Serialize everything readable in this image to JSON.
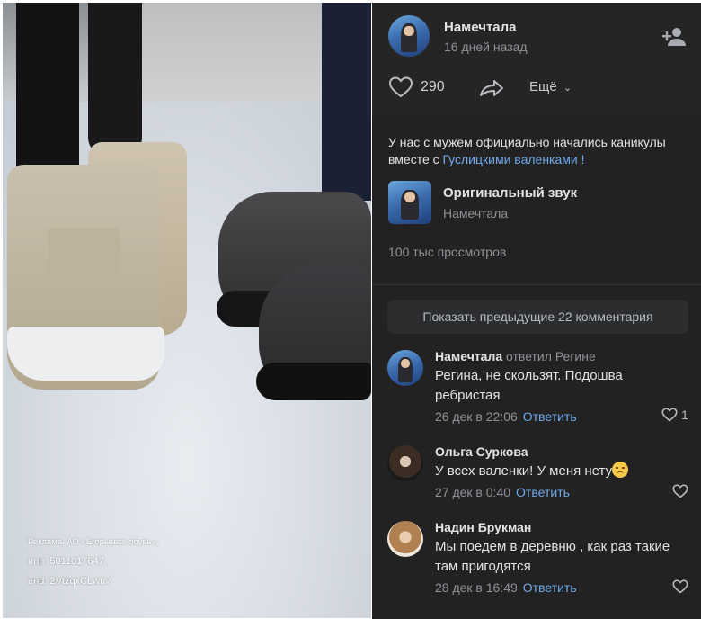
{
  "video": {
    "ad_lines": [
      "Реклама, АО «Егорьевск-обувь»,",
      "инн: 5011017647,",
      "erid: 2VtzqxCLwuv"
    ]
  },
  "post": {
    "author": "Намечтала",
    "date": "16 дней назад",
    "likes": "290",
    "more_label": "Ещё",
    "text_prefix": "У нас с мужем официально начались каникулы вместе с ",
    "text_link": "Гуслицкими валенками !",
    "sound_name": "Оригинальный звук",
    "sound_author": "Намечтала",
    "views": "100 тыс просмотров"
  },
  "comments_section": {
    "show_previous_label": "Показать предыдущие 22 комментария",
    "comments": [
      {
        "author": "Намечтала",
        "replied_to": "ответил Регине",
        "text": "Регина, не скользят. Подошва ребристая",
        "date": "26 дек в 22:06",
        "reply_label": "Ответить",
        "likes": "1"
      },
      {
        "author": "Ольга Суркова",
        "replied_to": "",
        "text": "У всех валенки! У меня нету",
        "date": "27 дек в 0:40",
        "reply_label": "Ответить",
        "likes": ""
      },
      {
        "author": "Надин Брукман",
        "replied_to": "",
        "text": "Мы поедем в деревню , как раз такие там пригодятся",
        "date": "28 дек в 16:49",
        "reply_label": "Ответить",
        "likes": ""
      }
    ]
  },
  "colors": {
    "panel_bg": "#222222",
    "link": "#71aaeb",
    "secondary_text": "#8f9399"
  }
}
